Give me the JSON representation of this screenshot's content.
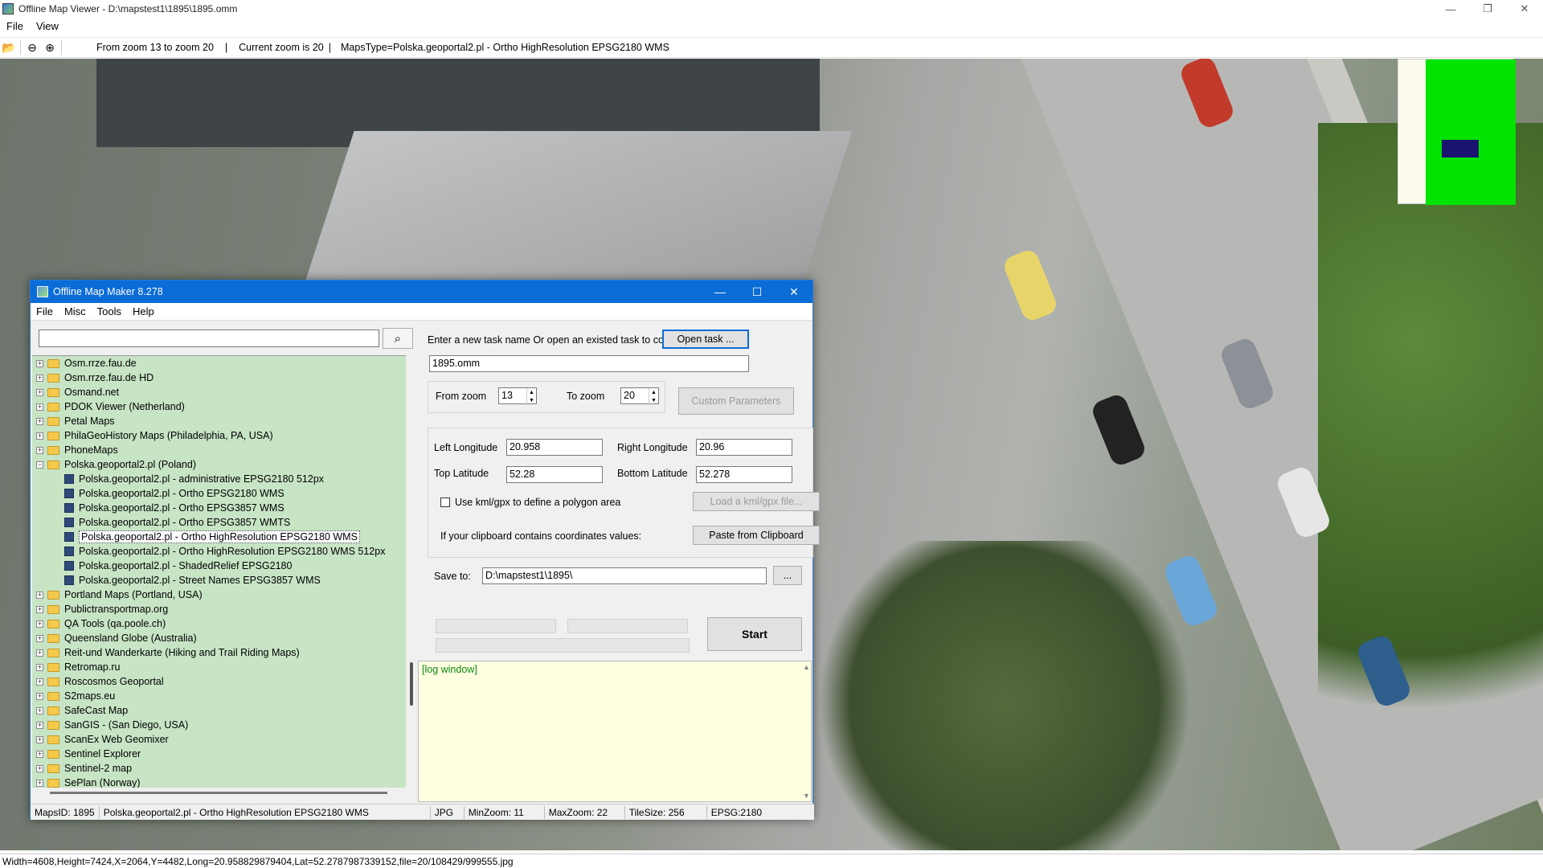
{
  "main_window": {
    "title": "Offline Map Viewer - D:\\mapstest1\\1895\\1895.omm",
    "menu": [
      "File",
      "View"
    ],
    "controls": {
      "minimize": "—",
      "restore": "❐",
      "close": "✕"
    }
  },
  "toolbar": {
    "zoom_range": "From zoom 13 to zoom 20",
    "current_zoom": "Current zoom is 20",
    "maps_type": "MapsType=Polska.geoportal2.pl - Ortho HighResolution EPSG2180 WMS",
    "separator": "|"
  },
  "map_status": "Width=4608,Height=7424,X=2064,Y=4482,Long=20.958829879404,Lat=52.2787987339152,file=20/108429/999555.jpg",
  "dialog": {
    "title": "Offline Map Maker 8.278",
    "menu": [
      "File",
      "Misc",
      "Tools",
      "Help"
    ],
    "search_placeholder": "",
    "tree": [
      {
        "label": "Osm.rrze.fau.de",
        "expanded": false,
        "level": 0
      },
      {
        "label": "Osm.rrze.fau.de HD",
        "expanded": false,
        "level": 0
      },
      {
        "label": "Osmand.net",
        "expanded": false,
        "level": 0
      },
      {
        "label": "PDOK Viewer (Netherland)",
        "expanded": false,
        "level": 0
      },
      {
        "label": "Petal Maps",
        "expanded": false,
        "level": 0
      },
      {
        "label": "PhilaGeoHistory Maps (Philadelphia, PA, USA)",
        "expanded": false,
        "level": 0
      },
      {
        "label": "PhoneMaps",
        "expanded": false,
        "level": 0
      },
      {
        "label": "Polska.geoportal2.pl (Poland)",
        "expanded": true,
        "level": 0
      },
      {
        "label": "Polska.geoportal2.pl - administrative EPSG2180 512px",
        "level": 1
      },
      {
        "label": "Polska.geoportal2.pl - Ortho EPSG2180 WMS",
        "level": 1
      },
      {
        "label": "Polska.geoportal2.pl - Ortho EPSG3857 WMS",
        "level": 1
      },
      {
        "label": "Polska.geoportal2.pl - Ortho EPSG3857 WMTS",
        "level": 1
      },
      {
        "label": "Polska.geoportal2.pl - Ortho HighResolution EPSG2180 WMS",
        "level": 1,
        "selected": true
      },
      {
        "label": "Polska.geoportal2.pl - Ortho HighResolution EPSG2180 WMS 512px",
        "level": 1
      },
      {
        "label": "Polska.geoportal2.pl - ShadedRelief EPSG2180",
        "level": 1
      },
      {
        "label": "Polska.geoportal2.pl - Street Names EPSG3857 WMS",
        "level": 1
      },
      {
        "label": "Portland Maps (Portland, USA)",
        "expanded": false,
        "level": 0
      },
      {
        "label": "Publictransportmap.org",
        "expanded": false,
        "level": 0
      },
      {
        "label": "QA Tools (qa.poole.ch)",
        "expanded": false,
        "level": 0
      },
      {
        "label": "Queensland Globe (Australia)",
        "expanded": false,
        "level": 0
      },
      {
        "label": "Reit-und Wanderkarte (Hiking and Trail Riding Maps)",
        "expanded": false,
        "level": 0
      },
      {
        "label": "Retromap.ru",
        "expanded": false,
        "level": 0
      },
      {
        "label": "Roscosmos Geoportal",
        "expanded": false,
        "level": 0
      },
      {
        "label": "S2maps.eu",
        "expanded": false,
        "level": 0
      },
      {
        "label": "SafeCast Map",
        "expanded": false,
        "level": 0
      },
      {
        "label": "SanGIS - (San Diego, USA)",
        "expanded": false,
        "level": 0
      },
      {
        "label": "ScanEx Web Geomixer",
        "expanded": false,
        "level": 0
      },
      {
        "label": "Sentinel Explorer",
        "expanded": false,
        "level": 0
      },
      {
        "label": "Sentinel-2 map",
        "expanded": false,
        "level": 0
      },
      {
        "label": "SePlan (Norway)",
        "expanded": false,
        "level": 0
      }
    ],
    "task_prompt": "Enter a new task name Or open an existed task to continue:",
    "open_task_label": "Open task ...",
    "task_name": "1895.omm",
    "from_zoom_label": "From zoom",
    "from_zoom_value": "13",
    "to_zoom_label": "To zoom",
    "to_zoom_value": "20",
    "custom_params_label": "Custom Parameters",
    "left_lon_label": "Left Longitude",
    "left_lon_value": "20.958",
    "right_lon_label": "Right Longitude",
    "right_lon_value": "20.96",
    "top_lat_label": "Top Latitude",
    "top_lat_value": "52.28",
    "bottom_lat_label": "Bottom Latitude",
    "bottom_lat_value": "52.278",
    "kml_checkbox_label": "Use kml/gpx to define a polygon area",
    "load_kml_label": "Load a kml/gpx file...",
    "clipboard_prompt": "If your clipboard contains coordinates values:",
    "paste_label": "Paste from Clipboard",
    "save_to_label": "Save to:",
    "save_to_value": "D:\\mapstest1\\1895\\",
    "browse_label": "...",
    "start_label": "Start",
    "log_text": "[log window]",
    "status": {
      "maps_id": "MapsID: 1895",
      "map_name": "Polska.geoportal2.pl - Ortho HighResolution EPSG2180 WMS",
      "format": "JPG",
      "min_zoom": "MinZoom: 11",
      "max_zoom": "MaxZoom: 22",
      "tile_size": "TileSize: 256",
      "epsg": "EPSG:2180"
    }
  },
  "colors": {
    "tree_bg": "#c7e4c5",
    "dialog_title_bg": "#0a6cd6",
    "log_bg": "#fffee1",
    "minimap_green": "#00e400",
    "minimap_rect": "#1a1470"
  }
}
